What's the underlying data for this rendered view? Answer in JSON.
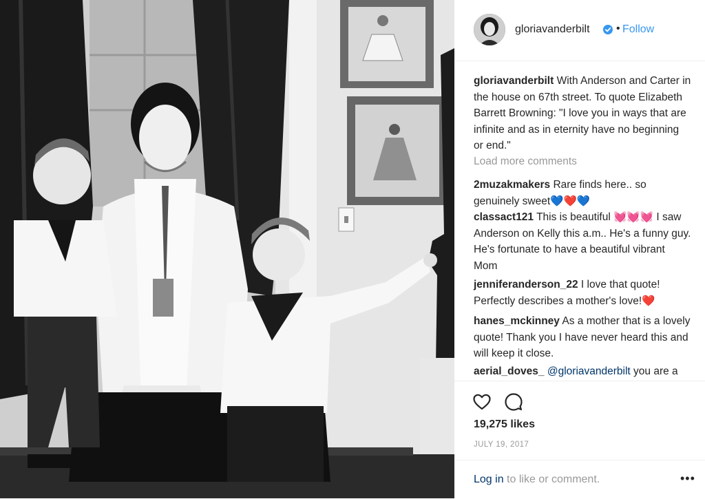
{
  "post": {
    "username": "gloriavanderbilt",
    "follow_label": "Follow",
    "dot": "•",
    "caption_text": "With Anderson and Carter in the house on 67th street. To quote Elizabeth Barrett Browning: \"I love you in ways that are infinite and as in eternity have no beginning or end.\"",
    "load_more": "Load more comments",
    "likes": "19,275 likes",
    "date": "JULY 19, 2017"
  },
  "comments": [
    {
      "user": "2muzakmakers",
      "text": "Rare finds here.. so genuinely sweet",
      "emoji": "💙❤️💙"
    },
    {
      "user": "classact121",
      "text_before": "This is beautiful",
      "emoji": "💓💓💓",
      "text_after": "I saw Anderson on Kelly this a.m.. He's a funny guy. He's fortunate to have a beautiful vibrant Mom"
    },
    {
      "user": "jenniferanderson_22",
      "text": "I love that quote! Perfectly describes a mother's love!",
      "emoji": "❤️"
    },
    {
      "user": "hanes_mckinney",
      "text": "As a mother that is a lovely quote! Thank you I have never heard this and will keep it close."
    },
    {
      "user": "aerial_doves_",
      "mention": "@gloriavanderbilt",
      "text": "you are a"
    }
  ],
  "footer": {
    "login_link": "Log in",
    "login_rest": "to like or comment.",
    "more": "•••"
  },
  "icons": {
    "verified": "verified-badge-icon",
    "like": "heart-outline-icon",
    "comment": "speech-bubble-icon",
    "more": "more-options-icon"
  },
  "colors": {
    "link_blue": "#3897f0",
    "mention_blue": "#003569",
    "muted": "#999999",
    "text": "#262626"
  }
}
